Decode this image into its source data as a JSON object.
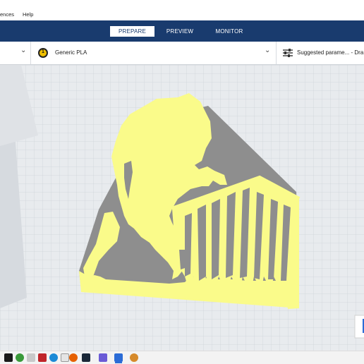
{
  "menu": {
    "items": [
      "ences",
      "Help"
    ]
  },
  "stages": {
    "tabs": [
      {
        "label": "PREPARE",
        "active": true
      },
      {
        "label": "PREVIEW",
        "active": false
      },
      {
        "label": "MONITOR",
        "active": false
      }
    ]
  },
  "settings": {
    "extruder_number": "1",
    "material": "Generic PLA",
    "print_profile": "Suggested parame... - Dra"
  },
  "colors": {
    "stage_bar": "#193b6e",
    "model_fill": "#fafb8a",
    "model_shadow": "#8d8d8d",
    "build_plate": "#e8ebee",
    "grid": "#cfd4d9"
  },
  "taskbar": {
    "icons": [
      "start-icon",
      "xbox-icon",
      "app-icon",
      "media-icon",
      "edge-icon",
      "calendar-icon",
      "firefox-icon",
      "steam-icon",
      "controller-icon",
      "cura-icon",
      "paint-icon"
    ]
  }
}
